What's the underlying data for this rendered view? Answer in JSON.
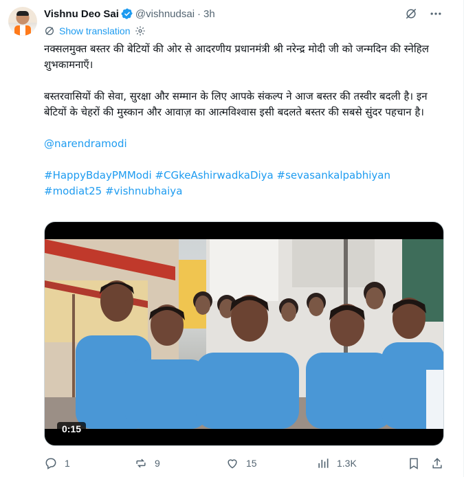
{
  "author": {
    "name": "Vishnu Deo Sai",
    "handle": "@vishnudsai",
    "separator": "·",
    "time": "3h"
  },
  "translate_label": "Show translation",
  "body": {
    "para1": "नक्सलमुक्त बस्तर की बेटियों की ओर से आदरणीय प्रधानमंत्री श्री नरेन्द्र मोदी जी को जन्मदिन की स्नेहिल शुभकामनाएँ।",
    "para2": "बस्तरवासियों की सेवा, सुरक्षा और सम्मान के लिए आपके संकल्प ने आज बस्तर की तस्वीर बदली है। इन बेटियों के चेहरों की मुस्कान और आवाज़ का आत्मविश्वास इसी बदलते बस्तर की सबसे सुंदर पहचान है।",
    "mention": "@narendramodi",
    "hashtags_line1": "#HappyBdayPMModi #CGkeAshirwadkaDiya #sevasankalpabhiyan",
    "hashtags_line2": "#modiat25 #vishnubhaiya"
  },
  "video": {
    "duration": "0:15"
  },
  "actions": {
    "replies": "1",
    "reposts": "9",
    "likes": "15",
    "views": "1.3K"
  },
  "colors": {
    "accent": "#1d9bf0",
    "muted": "#536471",
    "uniform": "#4a97d6"
  },
  "icons": [
    "verified-badge-icon",
    "grok-icon",
    "more-icon",
    "translate-icon",
    "gear-icon",
    "reply-icon",
    "repost-icon",
    "like-icon",
    "views-icon",
    "bookmark-icon",
    "share-icon"
  ]
}
